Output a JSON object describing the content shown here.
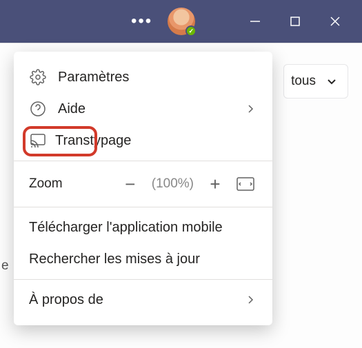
{
  "titlebar": {
    "more_label": "•••"
  },
  "bg": {
    "filter_label": "tous",
    "left_text": "e"
  },
  "menu": {
    "settings": "Paramètres",
    "help": "Aide",
    "cast": "Transtypage",
    "zoom_label": "Zoom",
    "zoom_value": "(100%)",
    "download_mobile": "Télécharger l'application mobile",
    "check_updates": "Rechercher les mises à jour",
    "about": "À propos de"
  }
}
